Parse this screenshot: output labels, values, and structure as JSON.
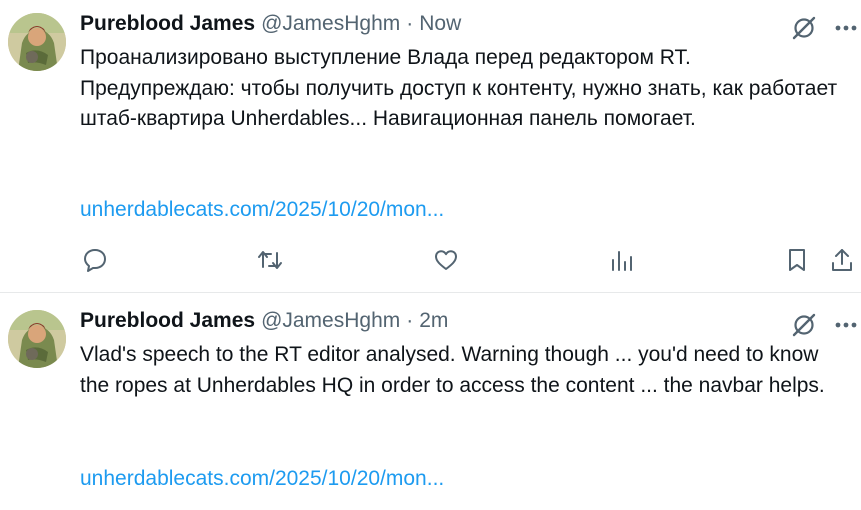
{
  "tweets": [
    {
      "author_name": "Pureblood James",
      "handle": "@JamesHghm",
      "separator": "·",
      "time": "Now",
      "text": "Проанализировано выступление Влада перед редактором RT.\nПредупреждаю: чтобы получить доступ к контенту, нужно знать, как работает штаб-квартира Unherdables... Навигационная панель помогает.",
      "link": "unherdablecats.com/2025/10/20/mon...",
      "icons": {
        "avatar": "profile-avatar",
        "grok": "grok-icon",
        "more": "more-icon",
        "reply": "reply-icon",
        "retweet": "retweet-icon",
        "like": "like-icon",
        "views": "views-icon",
        "bookmark": "bookmark-icon",
        "share": "share-icon"
      }
    },
    {
      "author_name": "Pureblood James",
      "handle": "@JamesHghm",
      "separator": "·",
      "time": "2m",
      "text": "Vlad's speech to the RT editor analysed.  Warning though ... you'd need to know the ropes at Unherdables HQ in order to access the content ... the navbar helps.",
      "link": "unherdablecats.com/2025/10/20/mon...",
      "icons": {
        "avatar": "profile-avatar",
        "grok": "grok-icon",
        "more": "more-icon"
      }
    }
  ],
  "colors": {
    "text": "#0f1419",
    "secondary": "#536471",
    "link": "#1d9bf0",
    "divider": "#e7e9ea"
  }
}
